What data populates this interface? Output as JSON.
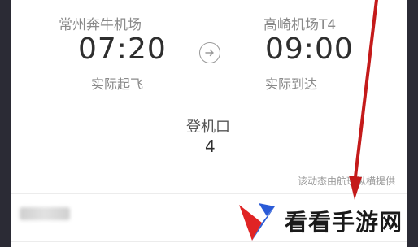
{
  "flight": {
    "departure": {
      "airport": "常州奔牛机场",
      "time": "07:20",
      "status": "实际起飞"
    },
    "arrival": {
      "airport": "高崎机场T4",
      "time": "09:00",
      "status": "实际到达"
    },
    "gate": {
      "label": "登机口",
      "value": "4"
    },
    "provider_note": "该动态由航班纵横提供"
  },
  "watermark": {
    "text": "看看手游网"
  },
  "colors": {
    "annotation_red": "#c41a1a",
    "text_dark": "#2e2e2e",
    "text_gray": "#8a8a8a"
  },
  "icons": {
    "route_arrow": "arrow-right-circle-icon"
  }
}
